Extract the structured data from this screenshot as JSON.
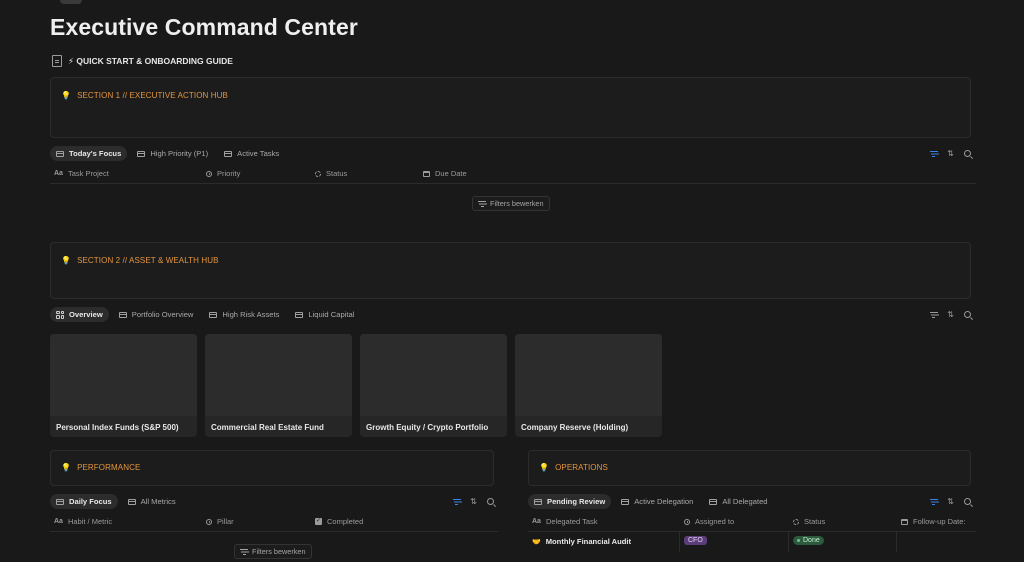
{
  "page": {
    "title": "Executive Command Center",
    "doc_link": "⚡ QUICK START & ONBOARDING GUIDE"
  },
  "section1": {
    "callout": "SECTION 1 // EXECUTIVE ACTION HUB",
    "tabs": [
      "Today's Focus",
      "High Priority (P1)",
      "Active Tasks"
    ],
    "columns": [
      "Task Project",
      "Priority",
      "Status",
      "Due Date"
    ],
    "filters_button": "Filters bewerken"
  },
  "section2": {
    "callout": "SECTION 2 // ASSET & WEALTH HUB",
    "tabs": [
      "Overview",
      "Portfolio Overview",
      "High Risk Assets",
      "Liquid Capital"
    ],
    "cards": [
      "Personal Index Funds (S&P 500)",
      "Commercial Real Estate Fund",
      "Growth Equity / Crypto Portfolio",
      "Company Reserve (Holding)"
    ]
  },
  "performance": {
    "callout": "PERFORMANCE",
    "tabs": [
      "Daily Focus",
      "All Metrics"
    ],
    "columns": [
      "Habit / Metric",
      "Pillar",
      "Completed"
    ],
    "filters_button": "Filters bewerken"
  },
  "operations": {
    "callout": "OPERATIONS",
    "tabs": [
      "Pending Review",
      "Active Delegation",
      "All Delegated"
    ],
    "columns": [
      "Delegated Task",
      "Assigned to",
      "Status",
      "Follow-up Date:"
    ],
    "rows": [
      {
        "task": "Monthly Financial Audit",
        "assigned": "CFO",
        "status": "Done"
      }
    ]
  },
  "colors": {
    "background": "#191919",
    "callout_text": "#e3953f",
    "accent_blue": "#3b82e6",
    "badge_purple": "#5b3d7a",
    "badge_green": "#2b5a3c"
  },
  "icons": {
    "filter": "filter-icon",
    "sort": "sort-icon",
    "search": "search-icon",
    "callout": "lightbulb-icon"
  }
}
